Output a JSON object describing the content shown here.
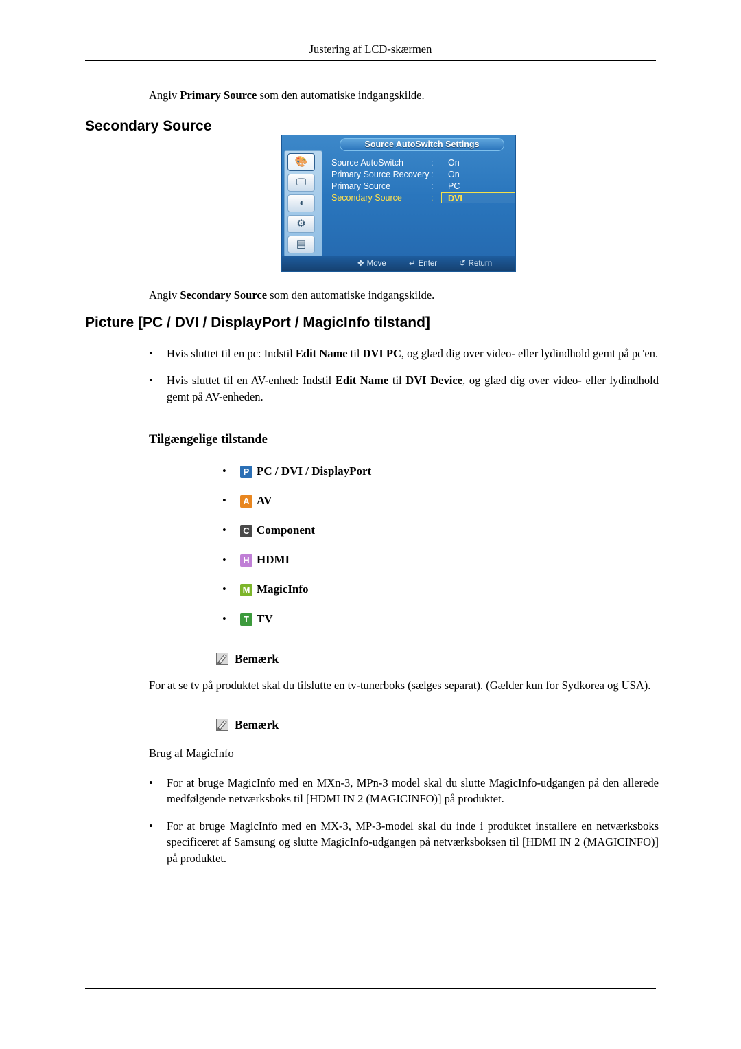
{
  "header": {
    "running_title": "Justering af LCD-skærmen"
  },
  "intro": {
    "prefix": "Angiv ",
    "bold": "Primary Source",
    "suffix": " som den automatiske indgangskilde."
  },
  "secondary_source": {
    "heading": "Secondary Source",
    "caption_prefix": "Angiv ",
    "caption_bold": "Secondary Source",
    "caption_suffix": " som den automatiske indgangskilde."
  },
  "osd": {
    "title": "Source AutoSwitch Settings",
    "rows": [
      {
        "label": "Source AutoSwitch",
        "colon": ":",
        "value": "On",
        "active": false
      },
      {
        "label": "Primary Source Recovery",
        "colon": ":",
        "value": "On",
        "active": false
      },
      {
        "label": "Primary Source",
        "colon": ":",
        "value": "PC",
        "active": false
      },
      {
        "label": "Secondary Source",
        "colon": ":",
        "value": "DVI",
        "active": true
      }
    ],
    "footer": [
      {
        "icon": "move-icon",
        "glyph": "✥",
        "label": "Move"
      },
      {
        "icon": "enter-icon",
        "glyph": "↵",
        "label": "Enter"
      },
      {
        "icon": "return-icon",
        "glyph": "↺",
        "label": "Return"
      }
    ],
    "sidebar_icons": [
      "picture-icon",
      "screen-icon",
      "sound-icon",
      "setup-icon",
      "multi-control-icon"
    ]
  },
  "picture_section": {
    "heading": "Picture [PC / DVI / DisplayPort / MagicInfo tilstand]",
    "bullets": [
      {
        "dot": "•",
        "parts": [
          {
            "t": "Hvis sluttet til en pc: Indstil ",
            "b": false
          },
          {
            "t": "Edit Name",
            "b": true
          },
          {
            "t": " til ",
            "b": false
          },
          {
            "t": "DVI PC",
            "b": true
          },
          {
            "t": ", og glæd dig over video- eller lydindhold gemt på pc'en.",
            "b": false
          }
        ]
      },
      {
        "dot": "•",
        "parts": [
          {
            "t": "Hvis sluttet til en AV-enhed: Indstil ",
            "b": false
          },
          {
            "t": "Edit Name",
            "b": true
          },
          {
            "t": " til ",
            "b": false
          },
          {
            "t": "DVI Device",
            "b": true
          },
          {
            "t": ", og glæd dig over video- eller lydindhold gemt på AV-enheden.",
            "b": false
          }
        ]
      }
    ],
    "subheading": "Tilgængelige tilstande",
    "modes": [
      {
        "dot": "•",
        "badge": "P",
        "color": "#2b6fb5",
        "label": "PC / DVI / DisplayPort"
      },
      {
        "dot": "•",
        "badge": "A",
        "color": "#e8861f",
        "label": "AV"
      },
      {
        "dot": "•",
        "badge": "C",
        "color": "#4a4a4a",
        "label": "Component"
      },
      {
        "dot": "•",
        "badge": "H",
        "color": "#c07fd6",
        "label": "HDMI"
      },
      {
        "dot": "•",
        "badge": "M",
        "color": "#7cb52a",
        "label": "MagicInfo"
      },
      {
        "dot": "•",
        "badge": "T",
        "color": "#3c9a3c",
        "label": "TV"
      }
    ]
  },
  "notes": [
    {
      "icon": "note-icon",
      "label": "Bemærk",
      "text": "For at se tv på produktet skal du tilslutte en tv-tunerboks (sælges separat). (Gælder kun for Sydkorea og USA)."
    },
    {
      "icon": "note-icon",
      "label": "Bemærk",
      "text": "Brug af MagicInfo"
    }
  ],
  "magicinfo_bullets": [
    {
      "dot": "•",
      "text": "For at bruge MagicInfo med en MXn-3, MPn-3 model skal du slutte MagicInfo-udgangen på den allerede medfølgende netværksboks til [HDMI IN 2 (MAGICINFO)] på produktet."
    },
    {
      "dot": "•",
      "text": "For at bruge MagicInfo med en MX-3, MP-3-model skal du inde i produktet installere en netværksboks specificeret af Samsung og slutte MagicInfo-udgangen på netværksboksen til [HDMI IN 2 (MAGICINFO)] på produktet."
    }
  ]
}
